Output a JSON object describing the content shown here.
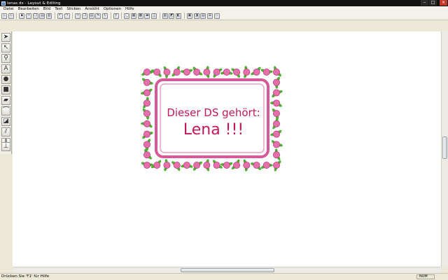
{
  "window": {
    "title": "lenas ds - Layout & Editing"
  },
  "menu": [
    "Datei",
    "Bearbeiten",
    "Bild",
    "Text",
    "Sticken",
    "Ansicht",
    "Optionen",
    "Hilfe"
  ],
  "toolbar": {
    "icons": [
      "new-icon",
      "open-icon",
      "save-icon",
      "cut-icon",
      "copy-icon",
      "paste-icon",
      "print-icon",
      "undo-icon",
      "redo-icon",
      "scissors-icon",
      "copy2-icon",
      "paste2-icon",
      "mirror-icon",
      "rotate-icon",
      "zoom-icon",
      "frame-icon",
      "fill-icon",
      "grid-icon",
      "ruler-icon",
      "hoop-icon",
      "stitch-icon",
      "3d-icon",
      "color-icon",
      "layer-icon",
      "preview-icon",
      "properties-icon",
      "network-icon",
      "monitor-icon"
    ]
  },
  "left_tools": [
    "select-arrow-icon",
    "node-edit-icon",
    "zoom-icon",
    "text-icon",
    "ellipse-icon",
    "rectangle-icon",
    "shape-icon",
    "curve-icon",
    "stitch-fill-icon",
    "satin-icon",
    "run-stitch-icon",
    "stamp-icon"
  ],
  "design": {
    "line1": "Dieser DS gehört:",
    "line2": "Lena !!!",
    "text_color": "#c2185b",
    "border_color": "#d45a9a",
    "flower_color": "#e46fa9",
    "leaf_color": "#4caf32"
  },
  "status": {
    "hint": "Drücken Sie 'F1' für Hilfe",
    "num": "NUM"
  }
}
